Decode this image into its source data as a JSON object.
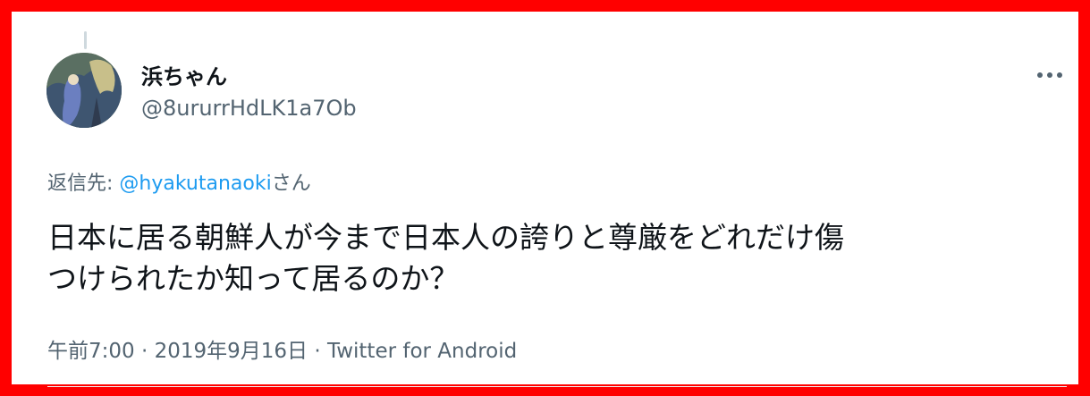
{
  "tweet": {
    "display_name": "浜ちゃん",
    "handle": "@8ururrHdLK1a7Ob",
    "reply_prefix": "返信先: ",
    "reply_mention": "@hyakutanaoki",
    "reply_suffix": "さん",
    "text_line1": "日本に居る朝鮮人が今まで日本人の誇りと尊厳をどれだけ傷",
    "text_line2": "つけられたか知って居るのか？",
    "time": "午前7:00",
    "separator": " · ",
    "date": "2019年9月16日",
    "source": "Twitter for Android"
  },
  "icons": {
    "more": "more-horizontal-icon"
  },
  "colors": {
    "border": "#ff0000",
    "text": "#0f1419",
    "secondary": "#536471",
    "link": "#1d9bf0"
  }
}
